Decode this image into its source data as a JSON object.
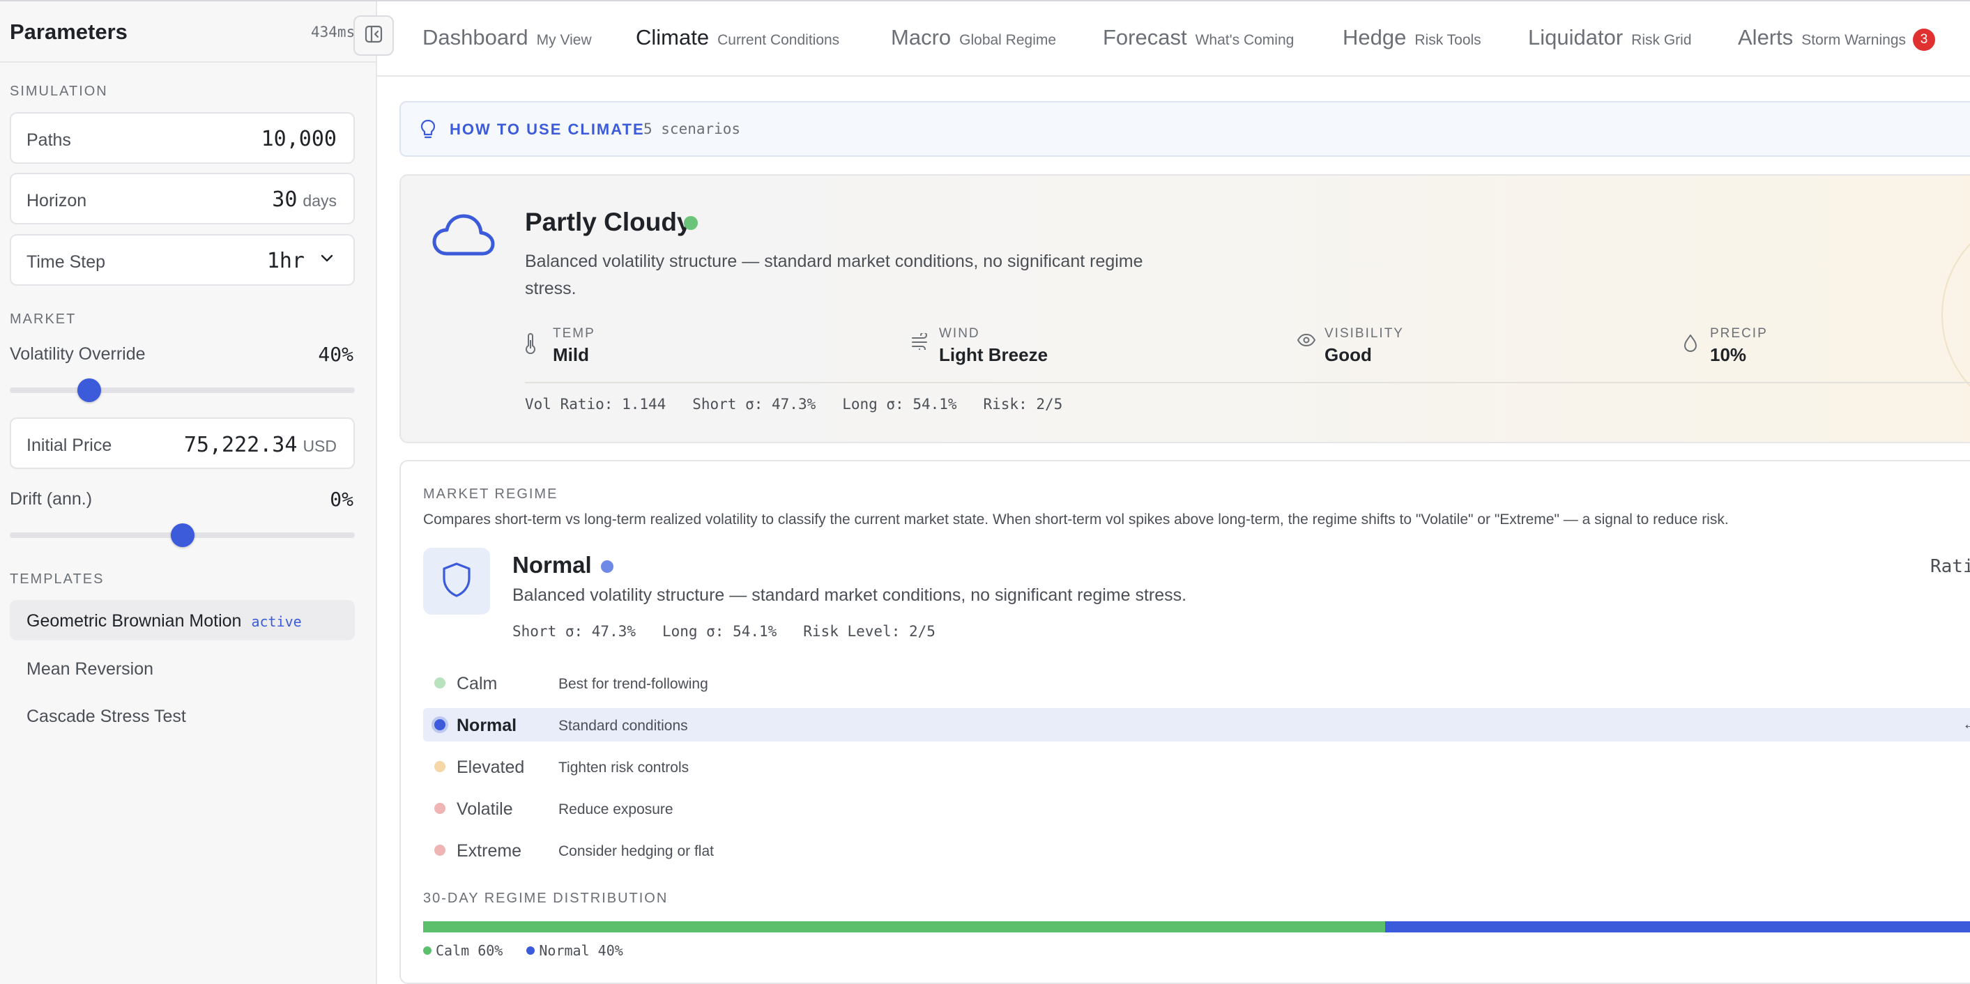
{
  "sidebar": {
    "title": "Parameters",
    "timing": "434ms",
    "simulation": {
      "section_label": "SIMULATION",
      "paths": {
        "label": "Paths",
        "value": "10,000"
      },
      "horizon": {
        "label": "Horizon",
        "value": "30",
        "unit": "days"
      },
      "time_step": {
        "label": "Time Step",
        "value": "1hr"
      }
    },
    "market": {
      "section_label": "MARKET",
      "volatility": {
        "label": "Volatility Override",
        "value": "40%",
        "fraction": 0.23
      },
      "initial_price": {
        "label": "Initial Price",
        "value": "75,222.34",
        "unit": "USD"
      },
      "drift": {
        "label": "Drift (ann.)",
        "value": "0%",
        "fraction": 0.5
      }
    },
    "templates": {
      "section_label": "TEMPLATES",
      "items": [
        {
          "label": "Geometric Brownian Motion",
          "badge": "active"
        },
        {
          "label": "Mean Reversion"
        },
        {
          "label": "Cascade Stress Test"
        }
      ]
    }
  },
  "nav": {
    "tabs": [
      {
        "label": "Dashboard",
        "sub": "My View"
      },
      {
        "label": "Climate",
        "sub": "Current Conditions"
      },
      {
        "label": "Macro",
        "sub": "Global Regime"
      },
      {
        "label": "Forecast",
        "sub": "What's Coming"
      },
      {
        "label": "Hedge",
        "sub": "Risk Tools"
      },
      {
        "label": "Liquidator",
        "sub": "Risk Grid"
      },
      {
        "label": "Alerts",
        "sub": "Storm Warnings",
        "badge": "3"
      }
    ],
    "active": "Climate"
  },
  "howto": {
    "title": "HOW TO USE CLIMATE",
    "count": "5 scenarios"
  },
  "weather": {
    "condition": "Partly Cloudy",
    "status_color": "#6cc47a",
    "description": "Balanced volatility structure — standard market conditions, no significant regime stress.",
    "metrics": [
      {
        "label": "TEMP",
        "value": "Mild",
        "icon": "thermometer-icon"
      },
      {
        "label": "WIND",
        "value": "Light Breeze",
        "icon": "wind-icon"
      },
      {
        "label": "VISIBILITY",
        "value": "Good",
        "icon": "eye-icon"
      },
      {
        "label": "PRECIP",
        "value": "10%",
        "icon": "droplet-icon"
      }
    ],
    "stats": {
      "vol_ratio": "Vol Ratio: 1.144",
      "short_sigma": "Short σ: 47.3%",
      "long_sigma": "Long σ: 54.1%",
      "risk": "Risk: 2/5"
    }
  },
  "regime": {
    "section_label": "MARKET REGIME",
    "explanation": "Compares short-term vs long-term realized volatility to classify the current market state. When short-term vol spikes above long-term, the regime shifts to \"Volatile\" or \"Extreme\" — a signal to reduce risk.",
    "current": "Normal",
    "current_color": "#6f8ae6",
    "description": "Balanced volatility structure — standard market conditions, no significant regime stress.",
    "stats": {
      "short_sigma": "Short σ: 47.3%",
      "long_sigma": "Long σ: 54.1%",
      "risk_level": "Risk Level: 2/5"
    },
    "ratio_label": "Rati",
    "levels": [
      {
        "name": "Calm",
        "desc": "Best for trend-following",
        "color": "#b9e3bf"
      },
      {
        "name": "Normal",
        "desc": "Standard conditions",
        "color": "#3b5bdb",
        "active": true,
        "arrow": "←"
      },
      {
        "name": "Elevated",
        "desc": "Tighten risk controls",
        "color": "#f6d7a7"
      },
      {
        "name": "Volatile",
        "desc": "Reduce exposure",
        "color": "#efb5b5"
      },
      {
        "name": "Extreme",
        "desc": "Consider hedging or flat",
        "color": "#efb5b5"
      }
    ],
    "distribution": {
      "label": "30-DAY REGIME DISTRIBUTION",
      "segments": [
        {
          "name": "Calm",
          "pct": 60,
          "label": "Calm 60%",
          "color": "#5cbf6b"
        },
        {
          "name": "Normal",
          "pct": 40,
          "label": "Normal 40%",
          "color": "#3b5bdb"
        }
      ]
    }
  }
}
